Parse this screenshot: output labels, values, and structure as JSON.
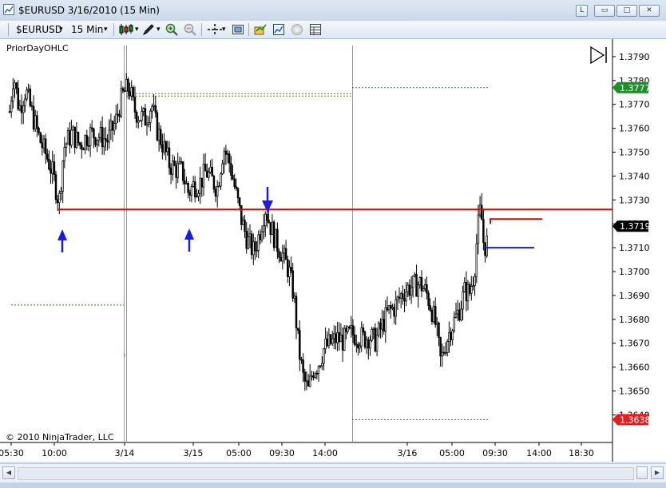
{
  "window": {
    "title": "$EURUSD  3/16/2010 (15 Min)",
    "buttons": {
      "l": "L",
      "minimize": "▭",
      "maximize": "□",
      "close": "✕"
    }
  },
  "toolbar": {
    "instrument": "$EURUSD",
    "interval": "15 Min",
    "dropdown_glyph": "▾",
    "icons": [
      "candlestick-icon",
      "pen-icon",
      "zoom-in-icon",
      "zoom-out-icon",
      "crosshair-icon",
      "properties-icon",
      "data-box-icon",
      "chart-style-icon",
      "circle-icon",
      "table-icon"
    ]
  },
  "chart": {
    "indicator_label": "PriorDayOHLC",
    "copyright": "© 2010 NinjaTrader, LLC",
    "price_axis_labels": [
      "1.3790",
      "1.3780",
      "1.3770",
      "1.3760",
      "1.3750",
      "1.3740",
      "1.3730",
      "1.3720",
      "1.3710",
      "1.3700",
      "1.3690",
      "1.3680",
      "1.3670",
      "1.3660",
      "1.3650",
      "1.3640"
    ],
    "time_axis_labels": [
      "05:30",
      "10:00",
      "3/14",
      "3/15",
      "05:00",
      "09:30",
      "14:00",
      "3/16",
      "05:00",
      "09:30",
      "14:00",
      "18:30"
    ],
    "tags": [
      {
        "value": "1.3777",
        "color": "#1f8f2a"
      },
      {
        "value": "1.3719",
        "color": "#000000"
      },
      {
        "value": "1.3638",
        "color": "#e02020"
      }
    ],
    "colors": {
      "support_line": "#e80000",
      "arrow": "#1c1ce0",
      "prior_high": "#1a8c1a",
      "prior_low": "#e02020",
      "prior_close": "#8a6a1a",
      "open_line": "#1c1cd0"
    }
  },
  "chart_data": {
    "type": "candlestick",
    "instrument": "$EURUSD",
    "timeframe": "15 Min",
    "date": "3/16/2010",
    "ylim": [
      1.3636,
      1.3797
    ],
    "tick_step": 0.001,
    "horizontal_line": 1.3726,
    "prior_day_high": 1.3777,
    "prior_day_low": 1.3638,
    "last_price": 1.3719,
    "annotations": [
      "up-arrow",
      "up-arrow",
      "down-arrow"
    ]
  }
}
